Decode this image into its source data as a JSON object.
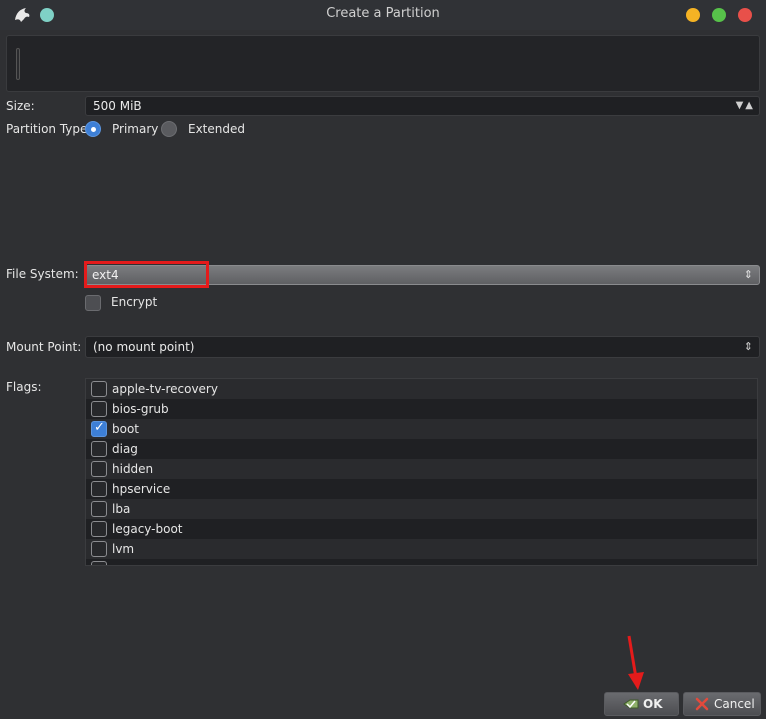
{
  "window": {
    "title": "Create a Partition"
  },
  "size": {
    "label": "Size:",
    "value": "500 MiB"
  },
  "partition_type": {
    "label": "Partition Type:",
    "options": [
      {
        "label": "Primary",
        "selected": true
      },
      {
        "label": "Extended",
        "selected": false
      }
    ]
  },
  "file_system": {
    "label": "File System:",
    "value": "ext4"
  },
  "encrypt": {
    "label": "Encrypt",
    "checked": false
  },
  "mount_point": {
    "label": "Mount Point:",
    "value": "(no mount point)"
  },
  "flags": {
    "label": "Flags:",
    "items": [
      {
        "name": "apple-tv-recovery",
        "checked": false
      },
      {
        "name": "bios-grub",
        "checked": false
      },
      {
        "name": "boot",
        "checked": true
      },
      {
        "name": "diag",
        "checked": false
      },
      {
        "name": "hidden",
        "checked": false
      },
      {
        "name": "hpservice",
        "checked": false
      },
      {
        "name": "lba",
        "checked": false
      },
      {
        "name": "legacy-boot",
        "checked": false
      },
      {
        "name": "lvm",
        "checked": false
      }
    ]
  },
  "buttons": {
    "ok": "OK",
    "cancel": "Cancel"
  },
  "icons": {
    "app": "eagle-icon",
    "ok": "ok-icon",
    "cancel": "cancel-icon",
    "annotation": "red-arrow-icon"
  },
  "colors": {
    "accent": "#3d7fd6",
    "highlight": "#e41b1b",
    "minimize": "#f5b324",
    "maximize": "#57c24a",
    "close": "#e8504a"
  }
}
